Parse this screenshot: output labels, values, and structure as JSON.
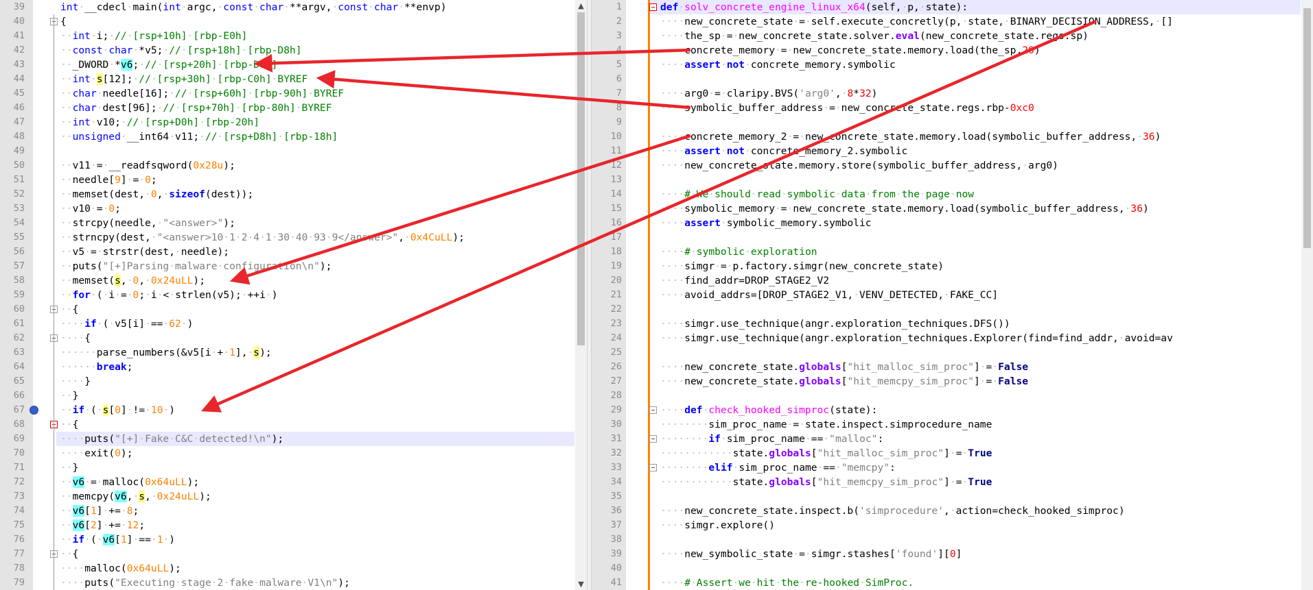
{
  "left_editor": {
    "lines": [
      {
        "n": "39",
        "html": "<span class=\"kw\">int</span>·__cdecl·main(<span class=\"kw\">int</span>·argc,·<span class=\"kw\">const</span>·<span class=\"kw\">char</span>·**argv,·<span class=\"kw\">const</span>·<span class=\"kw\">char</span>·**envp)"
      },
      {
        "n": "40",
        "html": "{"
      },
      {
        "n": "41",
        "html": "··<span class=\"kw\">int</span>·i;·<span class=\"cmt\">//·[rsp+10h]·[rbp-E0h]</span>"
      },
      {
        "n": "42",
        "html": "··<span class=\"kw\">const</span>·<span class=\"kw\">char</span>·*v5;·<span class=\"cmt\">//·[rsp+18h]·[rbp-D8h]</span>"
      },
      {
        "n": "43",
        "html": "··_DWORD·*<span class=\"hv6\">v6</span>;·<span class=\"cmt\">//·[rsp+20h]·[rbp-D0h]</span>"
      },
      {
        "n": "44",
        "html": "··<span class=\"kw\">int</span>·<span class=\"hs\">s</span>[12];·<span class=\"cmt\">//·[rsp+30h]·[rbp-C0h]·BYREF</span>"
      },
      {
        "n": "45",
        "html": "··<span class=\"kw\">char</span>·needle[16];·<span class=\"cmt\">//·[rsp+60h]·[rbp-90h]·BYREF</span>"
      },
      {
        "n": "46",
        "html": "··<span class=\"kw\">char</span>·dest[96];·<span class=\"cmt\">//·[rsp+70h]·[rbp-80h]·BYREF</span>"
      },
      {
        "n": "47",
        "html": "··<span class=\"kw\">int</span>·v10;·<span class=\"cmt\">//·[rsp+D0h]·[rbp-20h]</span>"
      },
      {
        "n": "48",
        "html": "··<span class=\"kw\">unsigned</span>·__int64·v11;·<span class=\"cmt\">//·[rsp+D8h]·[rbp-18h]</span>"
      },
      {
        "n": "49",
        "html": ""
      },
      {
        "n": "50",
        "html": "··v11·=·__readfsqword(<span class=\"num\">0x28u</span>);"
      },
      {
        "n": "51",
        "html": "··needle[<span class=\"num\">9</span>]·=·<span class=\"num\">0</span>;"
      },
      {
        "n": "52",
        "html": "··memset(dest,·<span class=\"num\">0</span>,·<span class=\"kwb\">sizeof</span>(dest));"
      },
      {
        "n": "53",
        "html": "··v10·=·<span class=\"num\">0</span>;"
      },
      {
        "n": "54",
        "html": "··strcpy(needle,·<span class=\"str\">\"&lt;answer&gt;\"</span>);"
      },
      {
        "n": "55",
        "html": "··strncpy(dest,·<span class=\"str\">\"&lt;answer&gt;10·1·2·4·1·30·40·93·9&lt;/answer&gt;\"</span>,·<span class=\"num\">0x4CuLL</span>);"
      },
      {
        "n": "56",
        "html": "··v5·=·strstr(dest,·needle);"
      },
      {
        "n": "57",
        "html": "··puts(<span class=\"str\">\"[+]Parsing·malware·configuration\\n\"</span>);"
      },
      {
        "n": "58",
        "html": "··memset(<span class=\"hs\">s</span>,·<span class=\"num\">0</span>,·<span class=\"num\">0x24uLL</span>);"
      },
      {
        "n": "59",
        "html": "··<span class=\"kwb\">for</span>·(·i·=·<span class=\"num\">0</span>;·i·&lt;·strlen(v5);·++i·)"
      },
      {
        "n": "60",
        "html": "··{"
      },
      {
        "n": "61",
        "html": "····<span class=\"kwb\">if</span>·(·v5[i]·==·<span class=\"num\">62</span>·)"
      },
      {
        "n": "62",
        "html": "····{"
      },
      {
        "n": "63",
        "html": "······parse_numbers(&amp;v5[i·+·<span class=\"num\">1</span>],·<span class=\"hs\">s</span>);"
      },
      {
        "n": "64",
        "html": "······<span class=\"kwb\">break</span>;"
      },
      {
        "n": "65",
        "html": "····}"
      },
      {
        "n": "66",
        "html": "··}"
      },
      {
        "n": "67",
        "html": "··<span class=\"kwb\">if</span>·(·<span class=\"hs\">s</span>[<span class=\"num\">0</span>]·!=·<span class=\"num\">10</span>·)"
      },
      {
        "n": "68",
        "html": "··{"
      },
      {
        "n": "69",
        "html": "····puts(<span class=\"str\">\"[+]·Fake·C&amp;C·detected!\\n\"</span>);"
      },
      {
        "n": "70",
        "html": "····exit(<span class=\"num\">0</span>);"
      },
      {
        "n": "71",
        "html": "··}"
      },
      {
        "n": "72",
        "html": "··<span class=\"hv6\">v6</span>·=·malloc(<span class=\"num\">0x64uLL</span>);"
      },
      {
        "n": "73",
        "html": "··memcpy(<span class=\"hv6\">v6</span>,·<span class=\"hs\">s</span>,·<span class=\"num\">0x24uLL</span>);"
      },
      {
        "n": "74",
        "html": "··<span class=\"hv6\">v6</span>[<span class=\"num\">1</span>]·+=·<span class=\"num\">8</span>;"
      },
      {
        "n": "75",
        "html": "··<span class=\"hv6\">v6</span>[<span class=\"num\">2</span>]·+=·<span class=\"num\">12</span>;"
      },
      {
        "n": "76",
        "html": "··<span class=\"kwb\">if</span>·(·<span class=\"hv6\">v6</span>[<span class=\"num\">1</span>]·==·<span class=\"num\">1</span>·)"
      },
      {
        "n": "77",
        "html": "··{"
      },
      {
        "n": "78",
        "html": "····malloc(<span class=\"num\">0x64uLL</span>);"
      },
      {
        "n": "79",
        "html": "····puts(<span class=\"str\">\"Executing·stage·2·fake·malware·V1\\n\"</span>);"
      }
    ]
  },
  "right_editor": {
    "lines": [
      {
        "n": "1",
        "html": "<span class=\"kwb\">def</span>·<span class=\"fnname\">solv_concrete_engine_linux_x64</span>(self,·p,·state):"
      },
      {
        "n": "2",
        "html": "····new_concrete_state·=·self.execute_concretly(p,·state,·BINARY_DECISION_ADDRESS,·[]"
      },
      {
        "n": "3",
        "html": "····the_sp·=·new_concrete_state.solver.<span class=\"fnb\">eval</span>(new_concrete_state.regs.sp)"
      },
      {
        "n": "4",
        "html": "····concrete_memory·=·new_concrete_state.memory.load(the_sp,<span class=\"num\" style=\"color:#ff0000\">20</span>)"
      },
      {
        "n": "5",
        "html": "····<span class=\"kwb\">assert</span>·<span class=\"kwb\">not</span>·concrete_memory.symbolic"
      },
      {
        "n": "6",
        "html": ""
      },
      {
        "n": "7",
        "html": "····arg0·=·claripy.BVS(<span class=\"str\">'arg0'</span>,·<span class=\"num\" style=\"color:#ff0000\">8</span>*<span class=\"num\" style=\"color:#ff0000\">32</span>)"
      },
      {
        "n": "8",
        "html": "····symbolic_buffer_address·=·new_concrete_state.regs.rbp-<span class=\"num\" style=\"color:#ff0000\">0xc0</span>"
      },
      {
        "n": "9",
        "html": ""
      },
      {
        "n": "10",
        "html": "····concrete_memory_2·=·new_concrete_state.memory.load(symbolic_buffer_address,·<span class=\"num\" style=\"color:#ff0000\">36</span>)"
      },
      {
        "n": "11",
        "html": "····<span class=\"kwb\">assert</span>·<span class=\"kwb\">not</span>·concrete_memory_2.symbolic"
      },
      {
        "n": "12",
        "html": "····new_concrete_state.memory.store(symbolic_buffer_address,·arg0)"
      },
      {
        "n": "13",
        "html": ""
      },
      {
        "n": "14",
        "html": "····<span class=\"cmt\">#·We·should·read·symbolic·data·from·the·page·now</span>"
      },
      {
        "n": "15",
        "html": "····symbolic_memory·=·new_concrete_state.memory.load(symbolic_buffer_address,·<span class=\"num\" style=\"color:#ff0000\">36</span>)"
      },
      {
        "n": "16",
        "html": "····<span class=\"kwb\">assert</span>·symbolic_memory.symbolic"
      },
      {
        "n": "17",
        "html": ""
      },
      {
        "n": "18",
        "html": "····<span class=\"cmt\">#·symbolic·exploration</span>"
      },
      {
        "n": "19",
        "html": "····simgr·=·p.factory.simgr(new_concrete_state)"
      },
      {
        "n": "20",
        "html": "····find_addr=DROP_STAGE2_V2"
      },
      {
        "n": "21",
        "html": "····avoid_addrs=[DROP_STAGE2_V1,·VENV_DETECTED,·FAKE_CC]"
      },
      {
        "n": "22",
        "html": ""
      },
      {
        "n": "23",
        "html": "····simgr.use_technique(angr.exploration_techniques.DFS())"
      },
      {
        "n": "24",
        "html": "····simgr.use_technique(angr.exploration_techniques.Explorer(find=find_addr,·avoid=av"
      },
      {
        "n": "25",
        "html": ""
      },
      {
        "n": "26",
        "html": "····new_concrete_state.<span class=\"fnb\">globals</span>[<span class=\"str\">\"hit_malloc_sim_proc\"</span>]·=·<span class=\"true\">False</span>"
      },
      {
        "n": "27",
        "html": "····new_concrete_state.<span class=\"fnb\">globals</span>[<span class=\"str\">\"hit_memcpy_sim_proc\"</span>]·=·<span class=\"true\">False</span>"
      },
      {
        "n": "28",
        "html": ""
      },
      {
        "n": "29",
        "html": "····<span class=\"kwb\">def</span>·<span class=\"fnname\">check_hooked_simproc</span>(state):"
      },
      {
        "n": "30",
        "html": "········sim_proc_name·=·state.inspect.simprocedure_name"
      },
      {
        "n": "31",
        "html": "········<span class=\"kwb\">if</span>·sim_proc_name·==·<span class=\"str\">\"malloc\"</span>:"
      },
      {
        "n": "32",
        "html": "············state.<span class=\"fnb\">globals</span>[<span class=\"str\">\"hit_malloc_sim_proc\"</span>]·=·<span class=\"true\">True</span>"
      },
      {
        "n": "33",
        "html": "········<span class=\"kwb\">elif</span>·sim_proc_name·==·<span class=\"str\">\"memcpy\"</span>:"
      },
      {
        "n": "34",
        "html": "············state.<span class=\"fnb\">globals</span>[<span class=\"str\">\"hit_memcpy_sim_proc\"</span>]·=·<span class=\"true\">True</span>"
      },
      {
        "n": "35",
        "html": ""
      },
      {
        "n": "36",
        "html": "····new_concrete_state.inspect.b(<span class=\"str\">'simprocedure'</span>,·action=check_hooked_simproc)"
      },
      {
        "n": "37",
        "html": "····simgr.explore()"
      },
      {
        "n": "38",
        "html": ""
      },
      {
        "n": "39",
        "html": "····new_symbolic_state·=·simgr.stashes[<span class=\"str\">'found'</span>][<span class=\"num\" style=\"color:#ff0000\">0</span>]"
      },
      {
        "n": "40",
        "html": ""
      },
      {
        "n": "41",
        "html": "····<span class=\"cmt\">#·Assert·we·hit·the·re-hooked·SimProc.</span>"
      }
    ]
  },
  "colors": {
    "arrow": "#e8262b",
    "current_line": "#e8e8ff",
    "fold_marker": "#ff8000",
    "highlight_v6": "#80ffff",
    "highlight_s": "#ffff80"
  },
  "icons": {
    "breakpoint": "breakpoint-icon",
    "scroll_up": "chevron-up-icon",
    "scroll_down": "chevron-down-icon"
  }
}
